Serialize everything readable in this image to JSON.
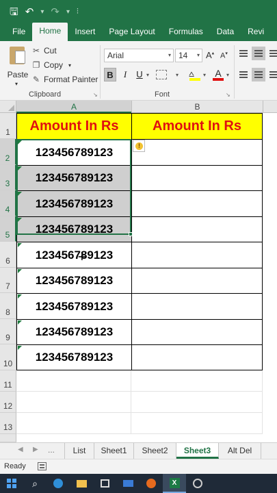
{
  "window": {
    "title_bar": {
      "save_icon": "save-icon",
      "undo_icon": "undo-icon",
      "redo_icon": "redo-icon",
      "customize_icon": "customize-quick-access-icon"
    }
  },
  "ribbon_tabs": [
    "File",
    "Home",
    "Insert",
    "Page Layout",
    "Formulas",
    "Data",
    "Revi"
  ],
  "clipboard": {
    "paste": "Paste",
    "cut": "Cut",
    "copy": "Copy",
    "format_painter": "Format Painter",
    "group_label": "Clipboard"
  },
  "font": {
    "family": "Arial",
    "size": "14",
    "group_label": "Font",
    "bold": "B",
    "italic": "I",
    "underline": "U",
    "grow": "A",
    "shrink": "A",
    "font_color": "A"
  },
  "grid": {
    "columns": [
      "A",
      "B"
    ],
    "rows": [
      "1",
      "2",
      "3",
      "4",
      "5",
      "6",
      "7",
      "8",
      "9",
      "10",
      "11",
      "12",
      "13"
    ],
    "header_text_a": "Amount In Rs",
    "header_text_b": "Amount In Rs",
    "values": [
      "123456789123",
      "123456789123",
      "123456789123",
      "123456789123",
      "123456789123",
      "123456789123",
      "123456789123",
      "123456789123",
      "123456789123"
    ],
    "colors": {
      "header_fill": "#ffff00",
      "header_text": "#e01010",
      "accent": "#217346"
    }
  },
  "sheets": {
    "tabs": [
      "List",
      "Sheet1",
      "Sheet2",
      "Sheet3",
      "Alt Del"
    ],
    "active": "Sheet3",
    "more": "..."
  },
  "status": {
    "text": "Ready"
  }
}
